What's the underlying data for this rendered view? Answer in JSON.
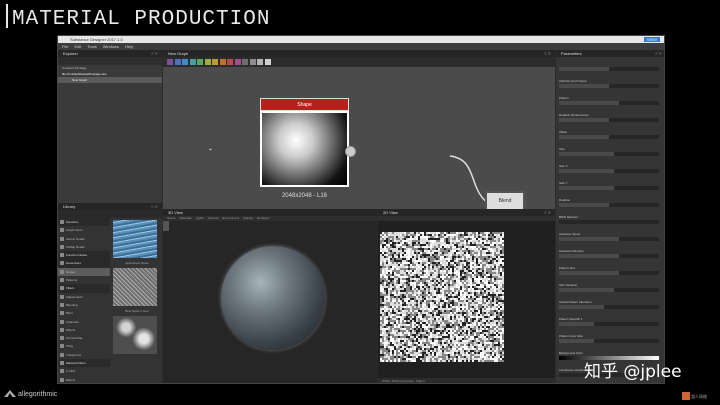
{
  "slide": {
    "title": "MATERIAL PRODUCTION",
    "watermark": "知乎 @jplee"
  },
  "app": {
    "window_title": "Substance Designer 2017.1.0",
    "logo": "VIEW",
    "menu": [
      "File",
      "Edit",
      "Tools",
      "Windows",
      "Help"
    ]
  },
  "explorer": {
    "title": "Explorer",
    "items": [
      "Unsaved Package",
      "file:///untitled/DefaultPackage.sbs",
      "New Graph"
    ]
  },
  "library": {
    "title": "Library",
    "categories": [
      {
        "label": "Favorites",
        "head": true
      },
      {
        "label": "Graph Items"
      },
      {
        "label": "Atomic Nodes"
      },
      {
        "label": "FxMap Nodes"
      },
      {
        "label": "Function Nodes",
        "head": true
      },
      {
        "label": "Generators",
        "head": true
      },
      {
        "label": "Noises",
        "sel": true
      },
      {
        "label": "Patterns"
      },
      {
        "label": "Filters",
        "head": true
      },
      {
        "label": "Adjustments"
      },
      {
        "label": "Blending"
      },
      {
        "label": "Blurs"
      },
      {
        "label": "Channels"
      },
      {
        "label": "Effects"
      },
      {
        "label": "Normal Map"
      },
      {
        "label": "Tiling"
      },
      {
        "label": "Transforms"
      },
      {
        "label": "Material Filters",
        "head": true
      },
      {
        "label": "1-Click"
      },
      {
        "label": "Effects"
      },
      {
        "label": "PBR Utilities"
      },
      {
        "label": "Scan Processing"
      }
    ],
    "thumbs": [
      "Anisotropic Noise",
      "Bnw Spots 1 Gen",
      "BnW Spots 2"
    ]
  },
  "graph": {
    "title": "New Graph",
    "node_shape": {
      "title": "Shape",
      "resolution": "2048x2048 - L16"
    },
    "node_blend": {
      "title": "Blend"
    },
    "swatch_colors": [
      "#7a4f9e",
      "#4f6fbf",
      "#3c8ec4",
      "#4aa0a0",
      "#5fa55f",
      "#9fae3f",
      "#c09a3a",
      "#c0712f",
      "#b74c4c",
      "#a44f8a",
      "#6e6e6e",
      "#8c8c8c",
      "#b5b5b5",
      "#d0d0d0"
    ]
  },
  "view3d": {
    "title": "3D View",
    "menu": [
      "Scene",
      "Materials",
      "Lights",
      "Camera",
      "Environment",
      "Display",
      "Renderer"
    ]
  },
  "view2d": {
    "title": "2D View",
    "footer": "2048 x 2048 (Grayscale, 16bpc)"
  },
  "params": {
    "title": "Parameters",
    "rows": [
      {
        "label": "",
        "value": "",
        "fill": 0.5
      },
      {
        "label": "Attribute Grid Output",
        "value": "",
        "fill": 0.5
      },
      {
        "label": "Pattern",
        "value": "",
        "fill": 0.6
      },
      {
        "label": "Rotation Randomness",
        "value": "",
        "fill": 0.5
      },
      {
        "label": "Offset",
        "value": "",
        "fill": 0.5
      },
      {
        "label": "Size",
        "value": "",
        "fill": 0.55
      },
      {
        "label": "Size X",
        "value": "",
        "fill": 0.55
      },
      {
        "label": "Size Y",
        "value": "",
        "fill": 0.55
      },
      {
        "label": "Rotation",
        "value": "",
        "fill": 0.5
      },
      {
        "label": "BNW Random",
        "value": "",
        "fill": 0.0
      },
      {
        "label": "Gaussian Spots",
        "value": "",
        "fill": 0.6
      },
      {
        "label": "Gaussian Random",
        "value": "",
        "fill": 0.6
      },
      {
        "label": "Pattern Size",
        "value": "",
        "fill": 0.6
      },
      {
        "label": "Size Variation",
        "value": "",
        "fill": 0.55
      },
      {
        "label": "Global Pattern Alteration",
        "value": "",
        "fill": 0.45
      },
      {
        "label": "Pattern Specific 1",
        "value": "",
        "fill": 0.35
      },
      {
        "label": "Pattern Input Size",
        "value": "",
        "fill": 0.35
      },
      {
        "label": "Background Color",
        "value": "",
        "fill": 1.0
      },
      {
        "label": "Luminance Variation",
        "value": "",
        "fill": 0.0
      }
    ]
  },
  "footer": {
    "brand": "allegorithmic",
    "partner": "游人网络"
  }
}
